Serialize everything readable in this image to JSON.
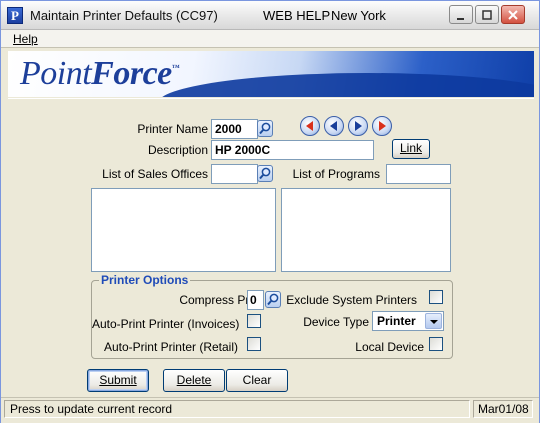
{
  "window": {
    "title": "Maintain Printer Defaults (CC97)",
    "help_label": "WEB HELP",
    "location": "New York",
    "app_icon_letter": "P"
  },
  "menu": {
    "items": [
      {
        "label": "Help"
      }
    ]
  },
  "banner": {
    "logo_part1": "Point",
    "logo_part2": "Force",
    "trademark": "™"
  },
  "form": {
    "printer_name_label": "Printer Name",
    "printer_name_value": "2000",
    "description_label": "Description",
    "description_value": "HP 2000C",
    "link_button": "Link",
    "sales_offices_label": "List of Sales Offices",
    "sales_offices_value": "",
    "programs_label": "List of Programs",
    "programs_value": ""
  },
  "printer_options": {
    "title": "Printer Options",
    "compress_print_label": "Compress Print",
    "compress_print_value": "0",
    "exclude_system_printers_label": "Exclude System Printers",
    "auto_print_invoices_label": "Auto-Print Printer (Invoices)",
    "device_type_label": "Device Type",
    "device_type_value": "Printer",
    "auto_print_retail_label": "Auto-Print Printer (Retail)",
    "local_device_label": "Local Device"
  },
  "buttons": {
    "submit": "Submit",
    "delete": "Delete",
    "clear": "Clear"
  },
  "status": {
    "message": "Press to update current record",
    "date": "Mar01/08"
  },
  "colors": {
    "accent_blue": "#1f4bb8",
    "nav_red": "#d9301c",
    "nav_blue": "#1a3f9a"
  }
}
